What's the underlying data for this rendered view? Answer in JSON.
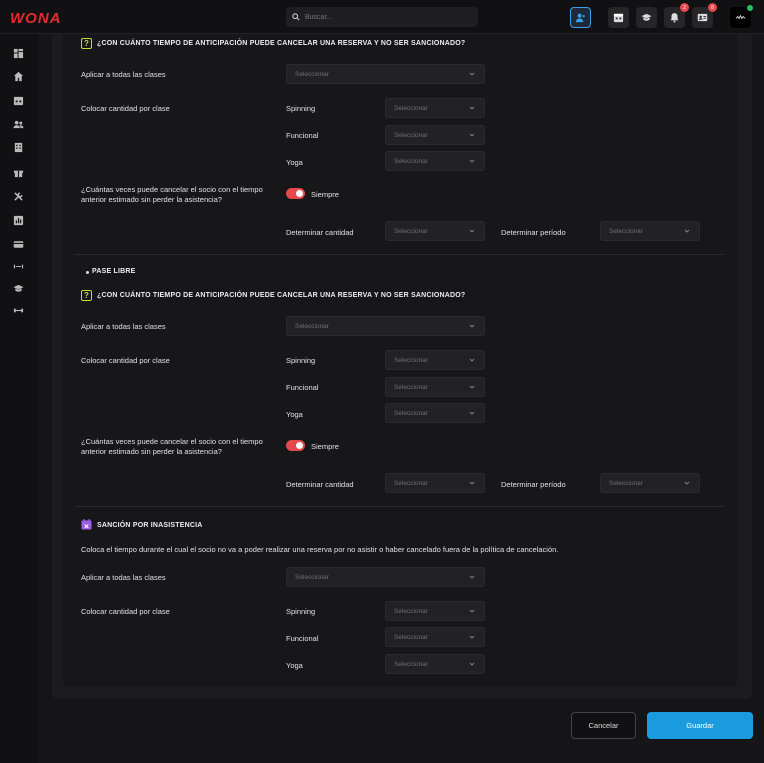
{
  "app": {
    "logo": "WONA"
  },
  "search": {
    "placeholder": "Buscar..."
  },
  "topbar": {
    "notifications_count": "2",
    "contacts_count": "8"
  },
  "sections": [
    {
      "title": "¿CON CUÁNTO TIEMPO DE ANTICIPACIÓN PUEDE CANCELAR UNA RESERVA Y NO SER SANCIONADO?",
      "apply_all_label": "Aplicar a todas las clases",
      "apply_all_value": "Seleccionar",
      "per_class_label": "Colocar cantidad por clase",
      "classes": [
        {
          "name": "Spinning",
          "value": "Seleccionar"
        },
        {
          "name": "Funcional",
          "value": "Seleccionar"
        },
        {
          "name": "Yoga",
          "value": "Seleccionar"
        }
      ],
      "times_question": "¿Cuántas veces puede cancelar el socio con el tiempo anterior estimado sin perder la asistencia?",
      "toggle_label": "Siempre",
      "toggle_on": true,
      "amount_label": "Determinar cantidad",
      "amount_value": "Seleccionar",
      "period_label": "Determinar período",
      "period_value": "Seleccionar"
    },
    {
      "plan": "PASE LIBRE",
      "title": "¿CON CUÁNTO TIEMPO DE ANTICIPACIÓN PUEDE CANCELAR UNA RESERVA Y NO SER SANCIONADO?",
      "apply_all_label": "Aplicar a todas las clases",
      "apply_all_value": "Seleccionar",
      "per_class_label": "Colocar cantidad por clase",
      "classes": [
        {
          "name": "Spinning",
          "value": "Seleccionar"
        },
        {
          "name": "Funcional",
          "value": "Seleccionar"
        },
        {
          "name": "Yoga",
          "value": "Seleccionar"
        }
      ],
      "times_question": "¿Cuántas veces puede cancelar el socio con el tiempo anterior estimado sin perder la asistencia?",
      "toggle_label": "Siempre",
      "toggle_on": true,
      "amount_label": "Determinar cantidad",
      "amount_value": "Seleccionar",
      "period_label": "Determinar período",
      "period_value": "Seleccionar"
    }
  ],
  "sanction": {
    "title": "SANCIÓN POR INASISTENCIA",
    "description": "Coloca el tiempo durante el cual el socio no va a poder realizar una reserva por no asistir o haber cancelado fuera de la política de cancelación.",
    "apply_all_label": "Aplicar a todas las clases",
    "apply_all_value": "Seleccionar",
    "per_class_label": "Colocar cantidad por clase",
    "classes": [
      {
        "name": "Spinning",
        "value": "Seleccionar"
      },
      {
        "name": "Funcional",
        "value": "Seleccionar"
      },
      {
        "name": "Yoga",
        "value": "Seleccionar"
      }
    ]
  },
  "actions": {
    "cancel_label": "Cancelar",
    "save_label": "Guardar"
  },
  "colors": {
    "accent": "#1a9be0",
    "danger": "#e5484d",
    "brand": "#e32b2b",
    "highlight": "#c8d93a"
  }
}
